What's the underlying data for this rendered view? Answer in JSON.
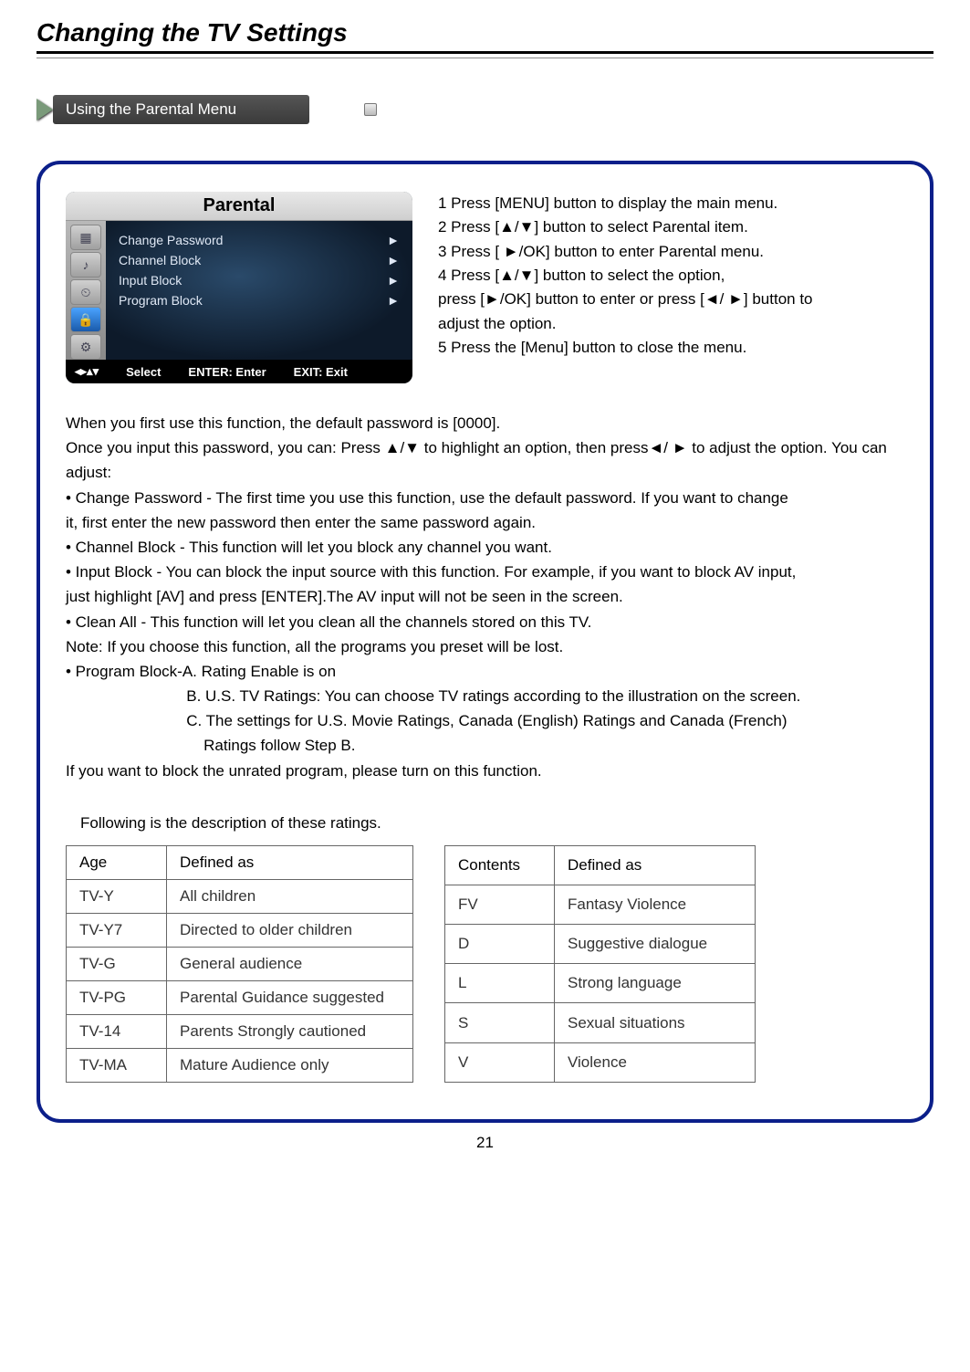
{
  "title": "Changing the TV Settings",
  "section_banner": "Using the Parental Menu",
  "osd": {
    "title": "Parental",
    "items": [
      {
        "label": "Change Password",
        "mark": "►"
      },
      {
        "label": "Channel Block",
        "mark": "►"
      },
      {
        "label": "Input Block",
        "mark": "►"
      },
      {
        "label": "Program Block",
        "mark": "►"
      }
    ],
    "footer_select": "Select",
    "footer_enter": "ENTER: Enter",
    "footer_exit": "EXIT: Exit"
  },
  "steps": [
    "1  Press [MENU] button to display the main menu.",
    "2  Press [▲/▼] button to select Parental item.",
    "3  Press [ ►/OK] button to enter Parental menu.",
    "4  Press [▲/▼] button to select the option,",
    "    press [►/OK] button to enter or press [◄/ ►] button to",
    "    adjust the option.",
    "5  Press the [Menu] button to close the menu."
  ],
  "body_lines": [
    " When you first use this function, the default password is [0000].",
    "Once you input this password, you can: Press ▲/▼ to highlight an option, then press◄/ ► to adjust the option. You can adjust:",
    "• Change Password - The first time you use this function, use the default password. If you want to change",
    "  it, first enter the new password then enter the same password again.",
    "• Channel Block - This function will let you block any channel you want.",
    "• Input Block - You can block the input source with this function. For example, if you want to block AV input,",
    "  just highlight [AV] and press [ENTER].The AV input will not be seen in the screen.",
    "• Clean All - This function will let you clean all the channels stored on this TV.",
    " Note: If you choose this function, all the programs you preset will be lost.",
    "• Program Block-A. Rating Enable is on",
    "                            B. U.S. TV Ratings: You can choose TV ratings according to the illustration on the screen.",
    "                            C. The settings for U.S. Movie Ratings, Canada (English) Ratings and Canada (French)",
    "                                Ratings follow Step B.",
    "    If you want to block the unrated program, please turn on this function."
  ],
  "ratings_intro": "Following is the description of these ratings.",
  "age_table": {
    "h1": "Age",
    "h2": "Defined as",
    "rows": [
      {
        "a": "TV-Y",
        "b": "All children"
      },
      {
        "a": "TV-Y7",
        "b": "Directed to older children"
      },
      {
        "a": "TV-G",
        "b": "General audience"
      },
      {
        "a": "TV-PG",
        "b": "Parental Guidance suggested"
      },
      {
        "a": "TV-14",
        "b": "Parents Strongly cautioned"
      },
      {
        "a": "TV-MA",
        "b": "Mature Audience only"
      }
    ]
  },
  "content_table": {
    "h1": "Contents",
    "h2": "Defined as",
    "rows": [
      {
        "a": "FV",
        "b": "Fantasy Violence"
      },
      {
        "a": "D",
        "b": "Suggestive dialogue"
      },
      {
        "a": "L",
        "b": "Strong language"
      },
      {
        "a": "S",
        "b": "Sexual situations"
      },
      {
        "a": "V",
        "b": "Violence"
      }
    ]
  },
  "page_number": "21"
}
